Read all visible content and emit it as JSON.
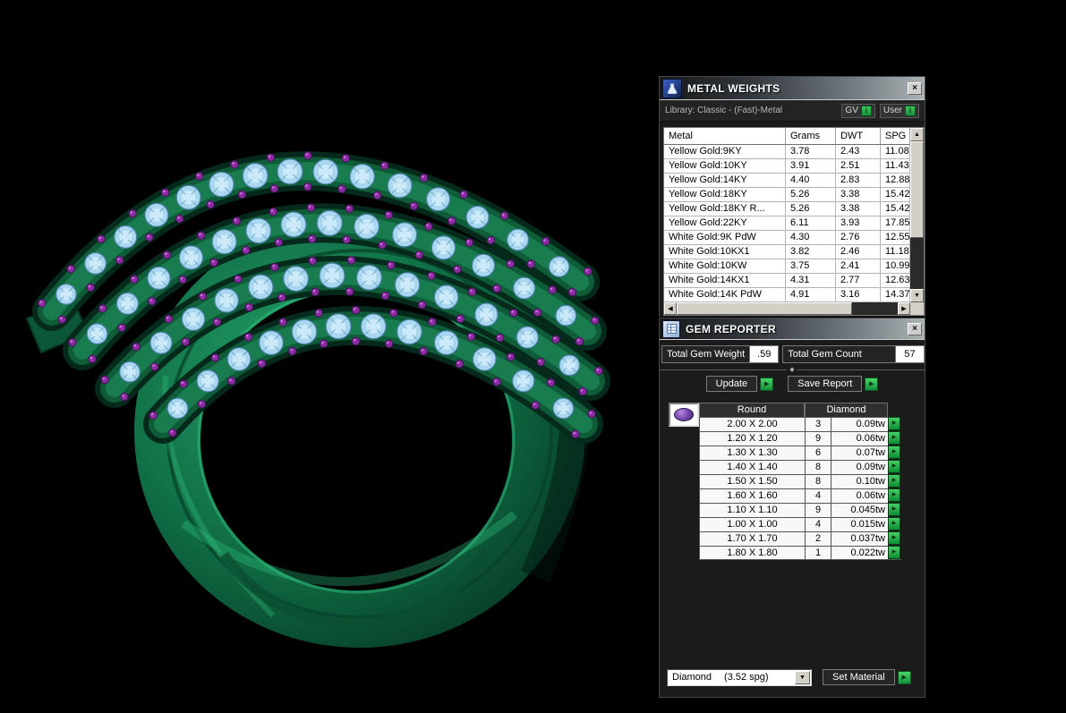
{
  "icons": {
    "close": "×",
    "scroll_up": "▲",
    "scroll_down": "▼",
    "scroll_left": "◀",
    "scroll_right": "▶",
    "dropdown": "▼",
    "action_arrow": "▶",
    "divider_marker": "◆",
    "indicator": "i"
  },
  "metal_weights": {
    "title": "METAL WEIGHTS",
    "library_label": "Library: Classic - (Fast)-Metal",
    "gv_label": "GV",
    "user_label": "User",
    "columns": [
      "Metal",
      "Grams",
      "DWT",
      "SPG"
    ],
    "rows": [
      {
        "metal": "Yellow Gold:9KY",
        "grams": "3.78",
        "dwt": "2.43",
        "spg": "11.08"
      },
      {
        "metal": "Yellow Gold:10KY",
        "grams": "3.91",
        "dwt": "2.51",
        "spg": "11.43"
      },
      {
        "metal": "Yellow Gold:14KY",
        "grams": "4.40",
        "dwt": "2.83",
        "spg": "12.88"
      },
      {
        "metal": "Yellow Gold:18KY",
        "grams": "5.26",
        "dwt": "3.38",
        "spg": "15.42"
      },
      {
        "metal": "Yellow Gold:18KY R...",
        "grams": "5.26",
        "dwt": "3.38",
        "spg": "15.42"
      },
      {
        "metal": "Yellow Gold:22KY",
        "grams": "6.11",
        "dwt": "3.93",
        "spg": "17.85"
      },
      {
        "metal": "White Gold:9K PdW",
        "grams": "4.30",
        "dwt": "2.76",
        "spg": "12.55"
      },
      {
        "metal": "White Gold:10KX1",
        "grams": "3.82",
        "dwt": "2.46",
        "spg": "11.18"
      },
      {
        "metal": "White Gold:10KW",
        "grams": "3.75",
        "dwt": "2.41",
        "spg": "10.99"
      },
      {
        "metal": "White Gold:14KX1",
        "grams": "4.31",
        "dwt": "2.77",
        "spg": "12.63"
      },
      {
        "metal": "White Gold:14K PdW",
        "grams": "4.91",
        "dwt": "3.16",
        "spg": "14.37"
      }
    ]
  },
  "gem_reporter": {
    "title": "GEM REPORTER",
    "total_weight_label": "Total Gem Weight",
    "total_weight_value": ".59",
    "total_count_label": "Total Gem Count",
    "total_count_value": "57",
    "update_label": "Update",
    "save_report_label": "Save Report",
    "table": {
      "shape_header": "Round",
      "material_header": "Diamond",
      "rows": [
        {
          "size": "2.00 X 2.00",
          "count": "3",
          "weight": "0.09tw"
        },
        {
          "size": "1.20 X 1.20",
          "count": "9",
          "weight": "0.06tw"
        },
        {
          "size": "1.30 X 1.30",
          "count": "6",
          "weight": "0.07tw"
        },
        {
          "size": "1.40 X 1.40",
          "count": "8",
          "weight": "0.09tw"
        },
        {
          "size": "1.50 X 1.50",
          "count": "8",
          "weight": "0.10tw"
        },
        {
          "size": "1.60 X 1.60",
          "count": "4",
          "weight": "0.06tw"
        },
        {
          "size": "1.10 X 1.10",
          "count": "9",
          "weight": "0.045tw"
        },
        {
          "size": "1.00 X 1.00",
          "count": "4",
          "weight": "0.015tw"
        },
        {
          "size": "1.70 X 1.70",
          "count": "2",
          "weight": "0.037tw"
        },
        {
          "size": "1.80 X 1.80",
          "count": "1",
          "weight": "0.022tw"
        }
      ]
    },
    "material_dropdown": {
      "material": "Diamond",
      "spg": "(3.52 spg)"
    },
    "set_material_label": "Set Material",
    "colors": {
      "accent_green": "#1e9e3e",
      "ring_green": "#0e5c38",
      "gem_blue": "#a9d7ef",
      "bead_purple": "#8b2da1"
    }
  }
}
